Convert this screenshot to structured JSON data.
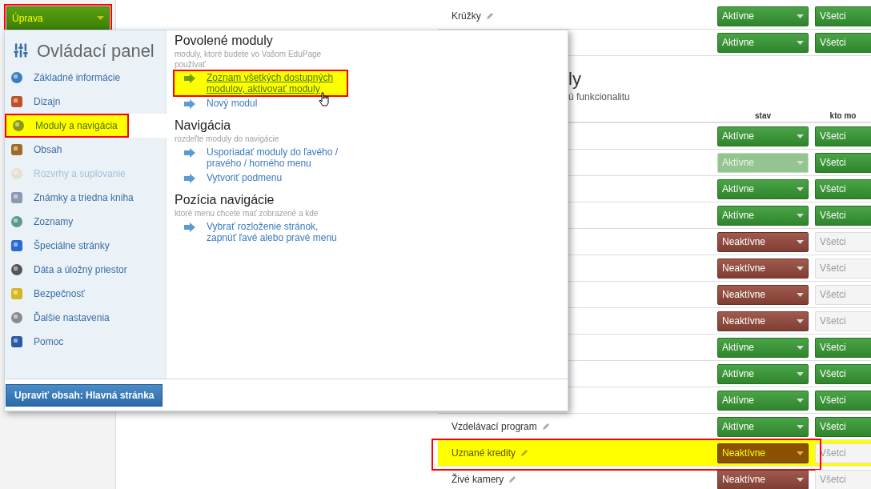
{
  "edit_button": {
    "label": "Úprava",
    "highlighted": true
  },
  "menu": {
    "title": "Ovládací panel",
    "items": [
      {
        "label": "Základné informácie",
        "selected": false,
        "disabled": false,
        "highlighted": false
      },
      {
        "label": "Dizajn",
        "selected": false,
        "disabled": false,
        "highlighted": false
      },
      {
        "label": "Moduly a navigácia",
        "selected": true,
        "disabled": false,
        "highlighted": true
      },
      {
        "label": "Obsah",
        "selected": false,
        "disabled": false,
        "highlighted": false
      },
      {
        "label": "Rozvrhy a suplovanie",
        "selected": false,
        "disabled": true,
        "highlighted": false
      },
      {
        "label": "Známky a triedna kniha",
        "selected": false,
        "disabled": false,
        "highlighted": false
      },
      {
        "label": "Zoznamy",
        "selected": false,
        "disabled": false,
        "highlighted": false
      },
      {
        "label": "Špeciálne stránky",
        "selected": false,
        "disabled": false,
        "highlighted": false
      },
      {
        "label": "Dáta a úložný priestor",
        "selected": false,
        "disabled": false,
        "highlighted": false
      },
      {
        "label": "Bezpečnosť",
        "selected": false,
        "disabled": false,
        "highlighted": false
      },
      {
        "label": "Ďalšie nastavenia",
        "selected": false,
        "disabled": false,
        "highlighted": false
      },
      {
        "label": "Pomoc",
        "selected": false,
        "disabled": false,
        "highlighted": false
      }
    ],
    "sections": [
      {
        "title": "Povolené moduly",
        "subtitle": "moduly, ktoré budete vo Vašom EduPage používať",
        "links": [
          {
            "text": "Zoznam všetkých dostupných modulov, aktivovať moduly",
            "highlighted": true
          },
          {
            "text": "Nový modul",
            "highlighted": false
          }
        ]
      },
      {
        "title": "Navigácia",
        "subtitle": "rozdeľte moduly do navigácie",
        "links": [
          {
            "text": "Usporiadať moduly do ľavého / pravého / horného menu",
            "highlighted": false
          },
          {
            "text": "Vytvoriť podmenu",
            "highlighted": false
          }
        ]
      },
      {
        "title": "Pozícia navigácie",
        "subtitle": "ktoré menu chcete mať zobrazené a kde",
        "links": [
          {
            "text": "Vybrať rozloženie stránok, zapnúť ľavé alebo pravé menu",
            "highlighted": false
          }
        ]
      }
    ],
    "footer_button": "Upraviť obsah: Hlavná stránka"
  },
  "top_rows": [
    {
      "name": "Krúžky",
      "status": "Aktívne",
      "kind": "active",
      "disabled": false,
      "highlighted": false,
      "who": "Všetci"
    },
    {
      "status": "Aktívne",
      "kind": "active",
      "disabled": false,
      "highlighted": false,
      "who": "Všetci"
    }
  ],
  "section": {
    "title": "ly",
    "subtitle": "ú funkcionalitu",
    "columns": [
      "stav",
      "kto mo"
    ]
  },
  "rows": [
    {
      "status": "Aktívne",
      "kind": "active",
      "disabled": false,
      "highlighted": false,
      "who": "Všetci"
    },
    {
      "status": "Aktívne",
      "kind": "active",
      "disabled": true,
      "highlighted": false,
      "who": "Všetci"
    },
    {
      "status": "Aktívne",
      "kind": "active",
      "disabled": false,
      "highlighted": false,
      "who": "Všetci"
    },
    {
      "status": "Aktívne",
      "kind": "active",
      "disabled": false,
      "highlighted": false,
      "who": "Všetci"
    },
    {
      "status": "Neaktívne",
      "kind": "inactive",
      "disabled": false,
      "highlighted": false,
      "who": "Všetci"
    },
    {
      "status": "Neaktívne",
      "kind": "inactive",
      "disabled": false,
      "highlighted": false,
      "who": "Všetci"
    },
    {
      "status": "Neaktívne",
      "kind": "inactive",
      "disabled": false,
      "highlighted": false,
      "who": "Všetci"
    },
    {
      "status": "Neaktívne",
      "kind": "inactive",
      "disabled": false,
      "highlighted": false,
      "who": "Všetci"
    },
    {
      "status": "Aktívne",
      "kind": "active",
      "disabled": false,
      "highlighted": false,
      "who": "Všetci"
    },
    {
      "status": "Aktívne",
      "kind": "active",
      "disabled": false,
      "highlighted": false,
      "who": "Všetci"
    },
    {
      "status": "Aktívne",
      "kind": "active",
      "disabled": false,
      "highlighted": false,
      "who": "Všetci"
    },
    {
      "name": "Vzdelávací program",
      "status": "Aktívne",
      "kind": "active",
      "disabled": false,
      "highlighted": false,
      "who": "Všetci"
    },
    {
      "name": "Uznané kredity",
      "status": "Neaktívne",
      "kind": "inactive",
      "disabled": false,
      "highlighted": true,
      "who": "Všetci"
    },
    {
      "name": "Živé kamery",
      "status": "Neaktívne",
      "kind": "inactive",
      "disabled": false,
      "highlighted": false,
      "who": "Všetci"
    }
  ]
}
